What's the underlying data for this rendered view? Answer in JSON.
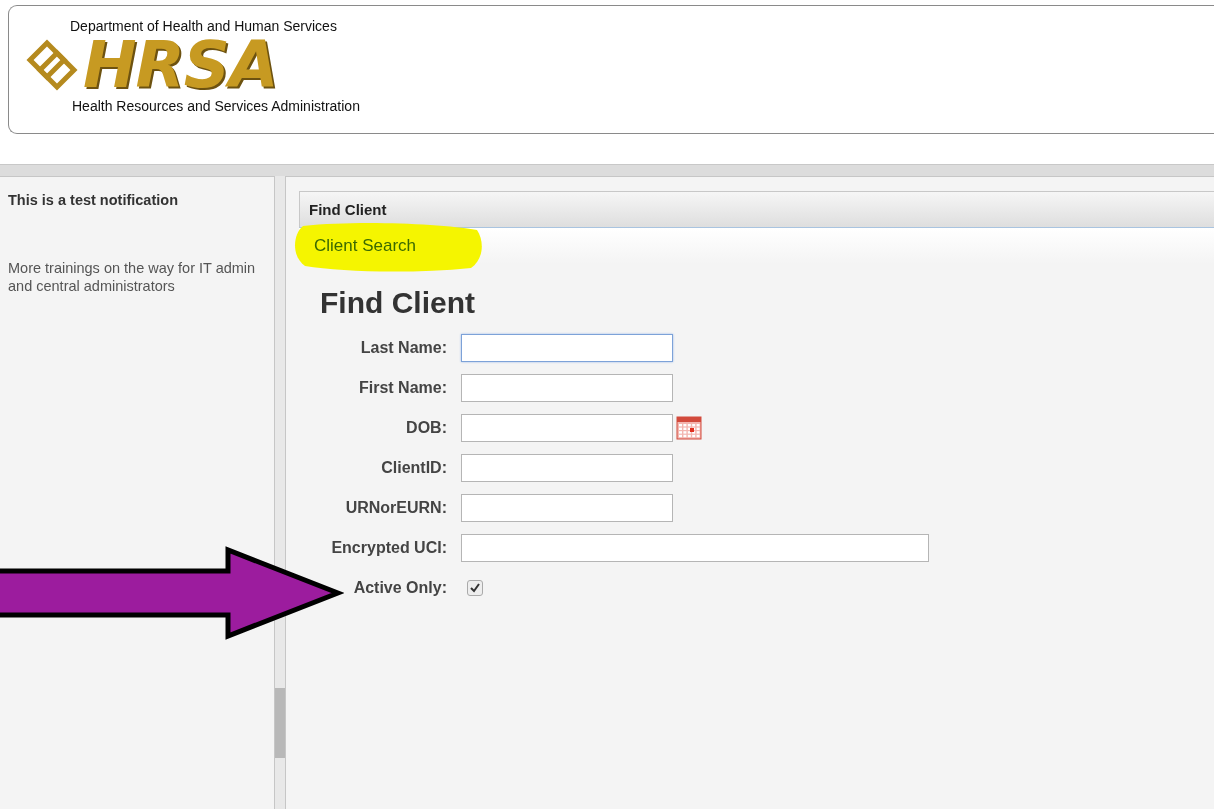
{
  "header": {
    "department": "Department of Health and Human Services",
    "logo_text": "HRSA",
    "agency": "Health Resources and Services Administration"
  },
  "sidebar": {
    "notices": [
      {
        "text": "This is a test notification",
        "emphasis": true
      },
      {
        "text": "More trainings on the way for IT admin and central administrators",
        "emphasis": false
      }
    ]
  },
  "panel": {
    "title": "Find Client",
    "tabs": [
      {
        "label": "Client Search",
        "selected": true,
        "highlighted": true
      }
    ],
    "heading": "Find Client",
    "fields": [
      {
        "kind": "text",
        "label": "Last Name:",
        "focused": true
      },
      {
        "kind": "text",
        "label": "First Name:",
        "focused": false
      },
      {
        "kind": "date",
        "label": "DOB:",
        "focused": false
      },
      {
        "kind": "text",
        "label": "ClientID:",
        "focused": false
      },
      {
        "kind": "text",
        "label": "URNorEURN:",
        "focused": false
      },
      {
        "kind": "wide",
        "label": "Encrypted UCI:",
        "focused": false
      },
      {
        "kind": "checkbox",
        "label": "Active Only:",
        "checked": true
      }
    ]
  },
  "annotation": {
    "kind": "arrow",
    "color": "#9c1c9e"
  }
}
